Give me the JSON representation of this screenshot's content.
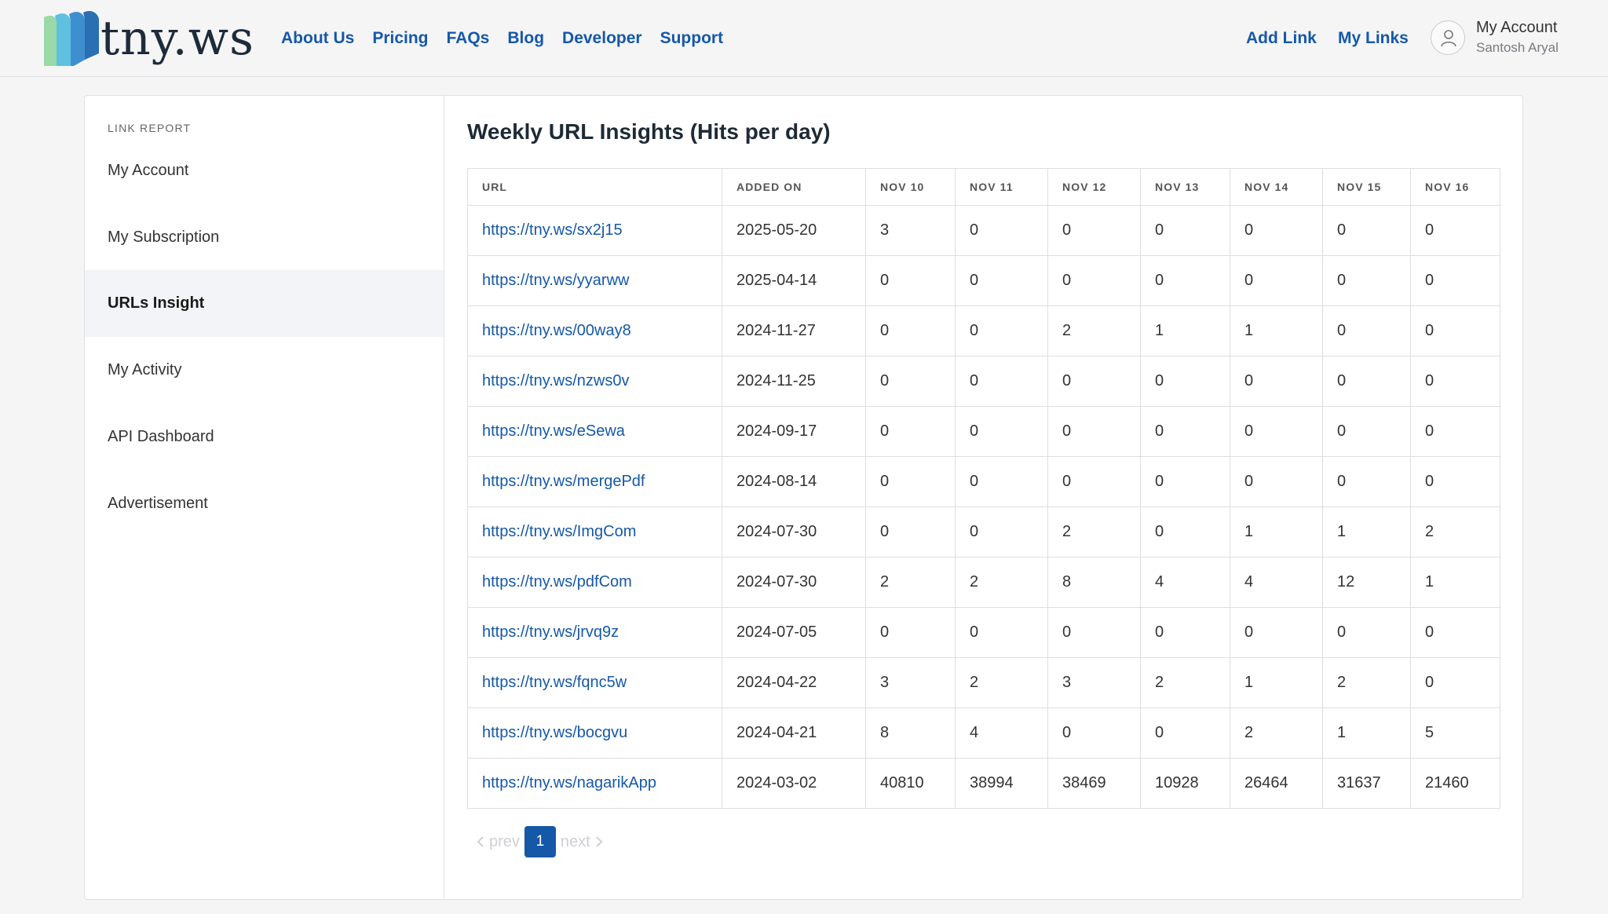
{
  "brand": {
    "name": "tny.ws",
    "colors": {
      "green": "#8fd4a3",
      "blue": "#4aa0d8",
      "link": "#1558a8"
    }
  },
  "nav": {
    "main": [
      "About Us",
      "Pricing",
      "FAQs",
      "Blog",
      "Developer",
      "Support"
    ],
    "add_link": "Add Link",
    "my_links": "My Links",
    "account": {
      "title": "My Account",
      "user": "Santosh Aryal",
      "icon": "user-icon"
    }
  },
  "sidebar": {
    "heading": "LINK REPORT",
    "items": [
      {
        "label": "My Account",
        "active": false
      },
      {
        "label": "My Subscription",
        "active": false
      },
      {
        "label": "URLs Insight",
        "active": true
      },
      {
        "label": "My Activity",
        "active": false
      },
      {
        "label": "API Dashboard",
        "active": false
      },
      {
        "label": "Advertisement",
        "active": false
      }
    ]
  },
  "main": {
    "title": "Weekly URL Insights (Hits per day)",
    "table": {
      "headers": [
        "URL",
        "ADDED ON",
        "NOV 10",
        "NOV 11",
        "NOV 12",
        "NOV 13",
        "NOV 14",
        "NOV 15",
        "NOV 16"
      ],
      "rows": [
        [
          "https://tny.ws/sx2j15",
          "2025-05-20",
          "3",
          "0",
          "0",
          "0",
          "0",
          "0",
          "0"
        ],
        [
          "https://tny.ws/yyarww",
          "2025-04-14",
          "0",
          "0",
          "0",
          "0",
          "0",
          "0",
          "0"
        ],
        [
          "https://tny.ws/00way8",
          "2024-11-27",
          "0",
          "0",
          "2",
          "1",
          "1",
          "0",
          "0"
        ],
        [
          "https://tny.ws/nzws0v",
          "2024-11-25",
          "0",
          "0",
          "0",
          "0",
          "0",
          "0",
          "0"
        ],
        [
          "https://tny.ws/eSewa",
          "2024-09-17",
          "0",
          "0",
          "0",
          "0",
          "0",
          "0",
          "0"
        ],
        [
          "https://tny.ws/mergePdf",
          "2024-08-14",
          "0",
          "0",
          "0",
          "0",
          "0",
          "0",
          "0"
        ],
        [
          "https://tny.ws/ImgCom",
          "2024-07-30",
          "0",
          "0",
          "2",
          "0",
          "1",
          "1",
          "2"
        ],
        [
          "https://tny.ws/pdfCom",
          "2024-07-30",
          "2",
          "2",
          "8",
          "4",
          "4",
          "12",
          "1"
        ],
        [
          "https://tny.ws/jrvq9z",
          "2024-07-05",
          "0",
          "0",
          "0",
          "0",
          "0",
          "0",
          "0"
        ],
        [
          "https://tny.ws/fqnc5w",
          "2024-04-22",
          "3",
          "2",
          "3",
          "2",
          "1",
          "2",
          "0"
        ],
        [
          "https://tny.ws/bocgvu",
          "2024-04-21",
          "8",
          "4",
          "0",
          "0",
          "2",
          "1",
          "5"
        ],
        [
          "https://tny.ws/nagarikApp",
          "2024-03-02",
          "40810",
          "38994",
          "38469",
          "10928",
          "26464",
          "31637",
          "21460"
        ]
      ]
    },
    "pagination": {
      "prev": "prev",
      "current": "1",
      "next": "next"
    }
  }
}
